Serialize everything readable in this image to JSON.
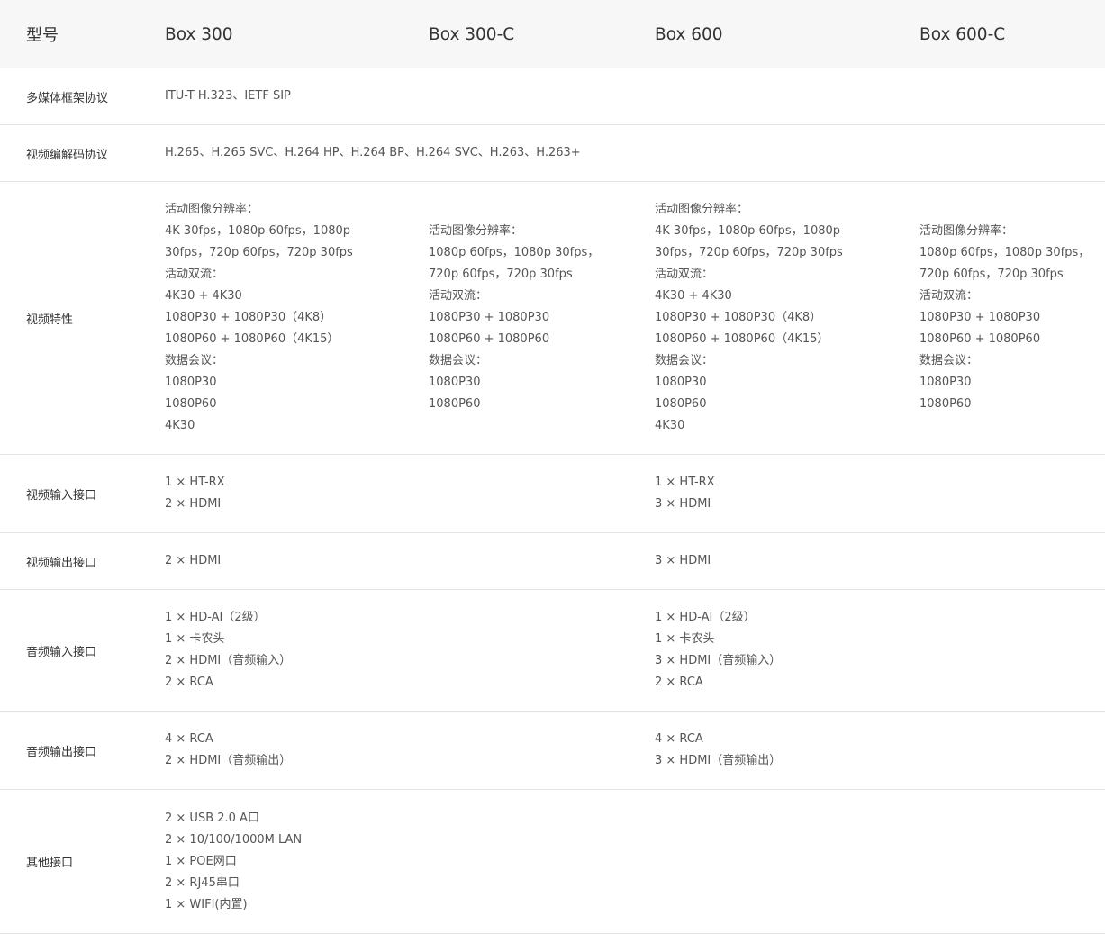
{
  "header": {
    "label": "型号",
    "models": [
      "Box 300",
      "Box 300-C",
      "Box 600",
      "Box 600-C"
    ]
  },
  "rows": [
    {
      "label": "多媒体框架协议",
      "cols": [
        [
          "ITU-T H.323、IETF SIP"
        ],
        [],
        [],
        []
      ]
    },
    {
      "label": "视频编解码协议",
      "cols": [
        [
          "H.265、H.265 SVC、H.264 HP、H.264 BP、H.264 SVC、H.263、H.263+"
        ],
        [],
        [],
        []
      ]
    },
    {
      "label": "视频特性",
      "cols": [
        [
          "活动图像分辨率：",
          "4K 30fps，1080p 60fps，1080p",
          "30fps，720p 60fps，720p 30fps",
          "活动双流：",
          "4K30 + 4K30",
          "1080P30 + 1080P30（4K8）",
          "1080P60 + 1080P60（4K15）",
          "数据会议：",
          "1080P30",
          "1080P60",
          "4K30"
        ],
        [
          "活动图像分辨率：",
          "1080p 60fps，1080p 30fps，",
          "720p 60fps，720p 30fps",
          "活动双流：",
          "1080P30 + 1080P30",
          "1080P60 + 1080P60",
          "数据会议：",
          "1080P30",
          "1080P60"
        ],
        [
          "活动图像分辨率：",
          "4K 30fps，1080p 60fps，1080p",
          "30fps，720p 60fps，720p 30fps",
          "活动双流：",
          "4K30 + 4K30",
          "1080P30 + 1080P30（4K8）",
          "1080P60 + 1080P60（4K15）",
          "数据会议：",
          "1080P30",
          "1080P60",
          "4K30"
        ],
        [
          "活动图像分辨率：",
          "1080p 60fps，1080p 30fps，",
          "720p 60fps，720p 30fps",
          "活动双流：",
          "1080P30 + 1080P30",
          "1080P60 + 1080P60",
          "数据会议：",
          "1080P30",
          "1080P60"
        ]
      ]
    },
    {
      "label": "视频输入接口",
      "cols": [
        [
          "1 × HT-RX",
          "2 × HDMI"
        ],
        [],
        [
          "1 × HT-RX",
          "3 × HDMI"
        ],
        []
      ]
    },
    {
      "label": "视频输出接口",
      "cols": [
        [
          "2 × HDMI"
        ],
        [],
        [
          "3 × HDMI"
        ],
        []
      ]
    },
    {
      "label": "音频输入接口",
      "cols": [
        [
          "1 × HD-AI（2级）",
          "1 × 卡农头",
          "2 × HDMI（音频输入）",
          "2 × RCA"
        ],
        [],
        [
          "1 × HD-AI（2级）",
          "1 × 卡农头",
          "3 × HDMI（音频输入）",
          "2 × RCA"
        ],
        []
      ]
    },
    {
      "label": "音频输出接口",
      "cols": [
        [
          "4 × RCA",
          "2 × HDMI（音频输出）"
        ],
        [],
        [
          "4 × RCA",
          "3 × HDMI（音频输出）"
        ],
        []
      ]
    },
    {
      "label": "其他接口",
      "cols": [
        [
          "2 × USB 2.0 A口",
          "2 × 10/100/1000M LAN",
          "1 × POE网口",
          "2 × RJ45串口",
          "1 × WIFI(内置)"
        ],
        [],
        [],
        []
      ]
    }
  ]
}
